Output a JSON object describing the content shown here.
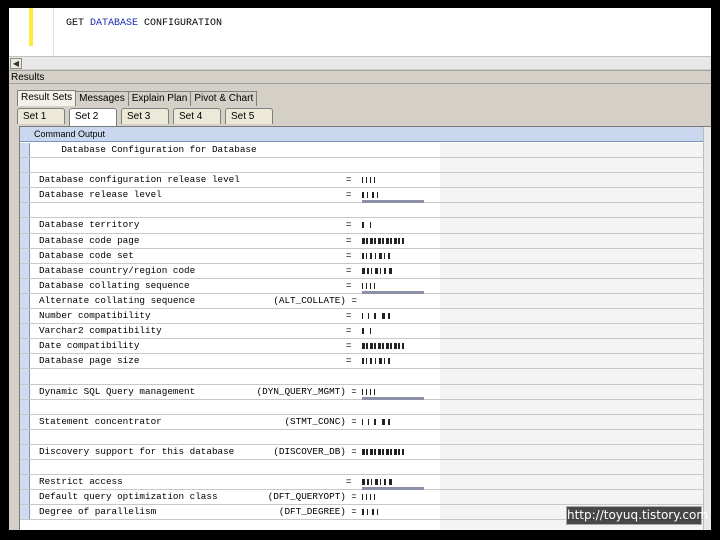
{
  "editor": {
    "sql_parts": [
      "GET ",
      "DATABASE",
      " CONFIGURATION"
    ],
    "scroll_left_glyph": "◀"
  },
  "results": {
    "label": "Results",
    "tabs": [
      "Result Sets",
      "Messages",
      "Explain Plan",
      "Pivot & Chart"
    ],
    "active_tab": "Result Sets",
    "set_tabs": [
      "Set 1",
      "Set 2",
      "Set 3",
      "Set 4",
      "Set 5"
    ],
    "active_set": "Set 2"
  },
  "output": {
    "header": "Command Output",
    "rows": [
      {
        "text": "    Database Configuration for Database",
        "value": null
      },
      {
        "text": "",
        "value": null
      },
      {
        "text": "Database configuration release level                   =",
        "value": "redacted"
      },
      {
        "text": "Database release level                                 =",
        "value": "redacted"
      },
      {
        "text": "",
        "value": null
      },
      {
        "text": "Database territory                                     =",
        "value": "redacted"
      },
      {
        "text": "Database code page                                     =",
        "value": "redacted"
      },
      {
        "text": "Database code set                                      =",
        "value": "redacted"
      },
      {
        "text": "Database country/region code                           =",
        "value": "redacted"
      },
      {
        "text": "Database collating sequence                            =",
        "value": "redacted"
      },
      {
        "text": "Alternate collating sequence              (ALT_COLLATE) =",
        "value": null
      },
      {
        "text": "Number compatibility                                   =",
        "value": "redacted"
      },
      {
        "text": "Varchar2 compatibility                                 =",
        "value": "redacted"
      },
      {
        "text": "Date compatibility                                     =",
        "value": "redacted"
      },
      {
        "text": "Database page size                                     =",
        "value": "redacted"
      },
      {
        "text": "",
        "value": null
      },
      {
        "text": "Dynamic SQL Query management           (DYN_QUERY_MGMT) =",
        "value": "redacted"
      },
      {
        "text": "",
        "value": null
      },
      {
        "text": "Statement concentrator                      (STMT_CONC) =",
        "value": "redacted"
      },
      {
        "text": "",
        "value": null
      },
      {
        "text": "Discovery support for this database       (DISCOVER_DB) =",
        "value": "redacted"
      },
      {
        "text": "",
        "value": null
      },
      {
        "text": "Restrict access                                        =",
        "value": "redacted"
      },
      {
        "text": "Default query optimization class         (DFT_QUERYOPT) =",
        "value": "redacted"
      },
      {
        "text": "Degree of parallelism                      (DFT_DEGREE) =",
        "value": "redacted"
      }
    ]
  },
  "watermark": "http://toyuq.tistory.com",
  "colors": {
    "keyword": "#1a2fb0",
    "header_bg": "#c9d8ee",
    "panel_bg": "#d4d0c8"
  }
}
